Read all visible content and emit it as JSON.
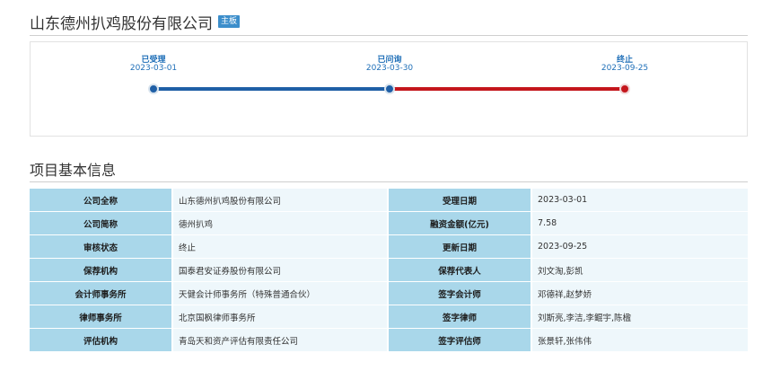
{
  "header": {
    "company_title": "山东德州扒鸡股份有限公司",
    "board_badge": "主板"
  },
  "timeline": {
    "steps": [
      {
        "label": "已受理",
        "date": "2023-03-01",
        "color": "#1f5fa6"
      },
      {
        "label": "已问询",
        "date": "2023-03-30",
        "color": "#1f5fa6"
      },
      {
        "label": "终止",
        "date": "2023-09-25",
        "color": "#c4161c"
      }
    ]
  },
  "section": {
    "title": "项目基本信息"
  },
  "info_table": {
    "rows": [
      {
        "label_left": "公司全称",
        "value_left": "山东德州扒鸡股份有限公司",
        "label_right": "受理日期",
        "value_right": "2023-03-01"
      },
      {
        "label_left": "公司简称",
        "value_left": "德州扒鸡",
        "label_right": "融资金额(亿元)",
        "value_right": "7.58"
      },
      {
        "label_left": "审核状态",
        "value_left": "终止",
        "label_right": "更新日期",
        "value_right": "2023-09-25"
      },
      {
        "label_left": "保荐机构",
        "value_left": "国泰君安证券股份有限公司",
        "label_right": "保荐代表人",
        "value_right": "刘文淘,彭凯"
      },
      {
        "label_left": "会计师事务所",
        "value_left": "天健会计师事务所（特殊普通合伙）",
        "label_right": "签字会计师",
        "value_right": "邓德祥,赵梦娇"
      },
      {
        "label_left": "律师事务所",
        "value_left": "北京国枫律师事务所",
        "label_right": "签字律师",
        "value_right": "刘斯亮,李洁,李鲲宇,陈楹"
      },
      {
        "label_left": "评估机构",
        "value_left": "青岛天和资产评估有限责任公司",
        "label_right": "签字评估师",
        "value_right": "张景轩,张伟伟"
      }
    ]
  }
}
